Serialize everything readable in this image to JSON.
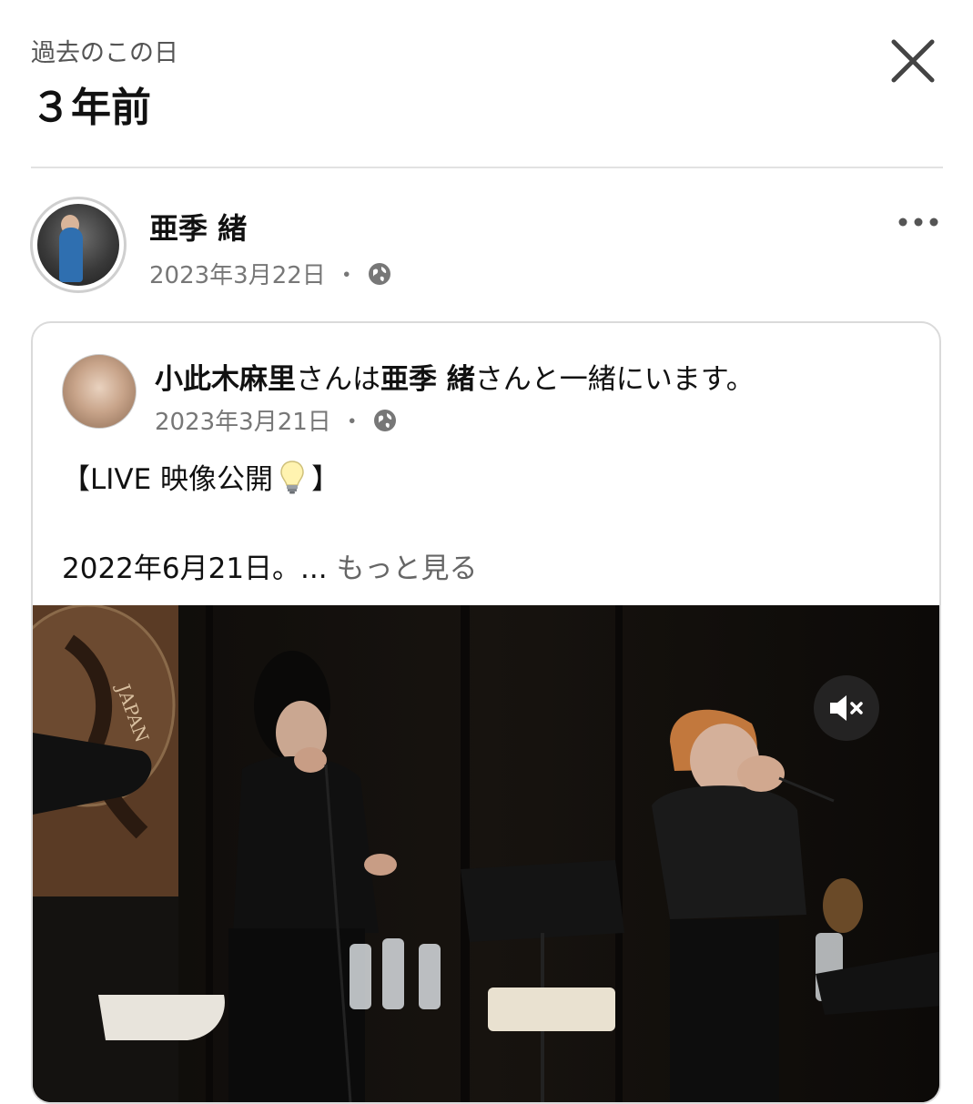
{
  "header": {
    "subtitle": "過去のこの日",
    "title": "３年前",
    "close_icon": "close-icon"
  },
  "post": {
    "author": "亜季 緒",
    "date": "2023年3月22日",
    "separator": "・",
    "privacy_icon": "globe-icon",
    "more_icon": "more-dots-icon"
  },
  "shared": {
    "author": "小此木麻里",
    "text_mid": "さんは",
    "with_name": "亜季 緒",
    "text_end": "さんと一緒にいます。",
    "date": "2023年3月21日",
    "separator": "・",
    "line1_prefix": "【LIVE 映像公開",
    "line1_suffix": "】",
    "line2": "2022年6月21日。...",
    "see_more": "もっと見る",
    "video_watermark": "JAPAN",
    "mute_icon": "mute-icon"
  }
}
